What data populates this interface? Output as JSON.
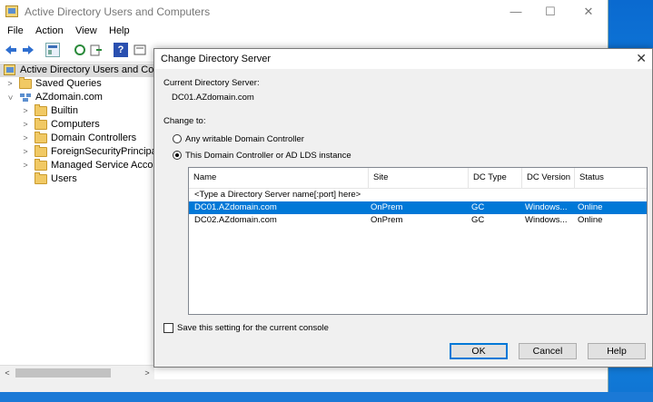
{
  "window": {
    "title": "Active Directory Users and Computers",
    "controls": {
      "minimize": "—",
      "maximize": "☐",
      "close": "✕"
    }
  },
  "menu": [
    "File",
    "Action",
    "View",
    "Help"
  ],
  "tree": {
    "root": "Active Directory Users and Com",
    "items": [
      {
        "label": "Saved Queries"
      },
      {
        "label": "AZdomain.com"
      },
      {
        "label": "Builtin"
      },
      {
        "label": "Computers"
      },
      {
        "label": "Domain Controllers"
      },
      {
        "label": "ForeignSecurityPrincipal"
      },
      {
        "label": "Managed Service Accou"
      },
      {
        "label": "Users"
      }
    ]
  },
  "dialog": {
    "title": "Change Directory Server",
    "current_label": "Current Directory Server:",
    "current_value": "DC01.AZdomain.com",
    "change_to_label": "Change to:",
    "radio_any": "Any writable Domain Controller",
    "radio_this": "This Domain Controller or AD LDS instance",
    "selected_radio": "radio_this",
    "columns": [
      "Name",
      "Site",
      "DC Type",
      "DC Version",
      "Status"
    ],
    "placeholder_row": "<Type a Directory Server name[:port] here>",
    "rows": [
      {
        "name": "DC01.AZdomain.com",
        "site": "OnPrem",
        "dc_type": "GC",
        "dc_version": "Windows...",
        "status": "Online",
        "selected": true
      },
      {
        "name": "DC02.AZdomain.com",
        "site": "OnPrem",
        "dc_type": "GC",
        "dc_version": "Windows...",
        "status": "Online",
        "selected": false
      }
    ],
    "save_setting_label": "Save this setting for the current console",
    "save_setting_checked": false,
    "buttons": {
      "ok": "OK",
      "cancel": "Cancel",
      "help": "Help"
    }
  },
  "colors": {
    "selection": "#0078d7",
    "desktop": "#1a7fd4"
  }
}
